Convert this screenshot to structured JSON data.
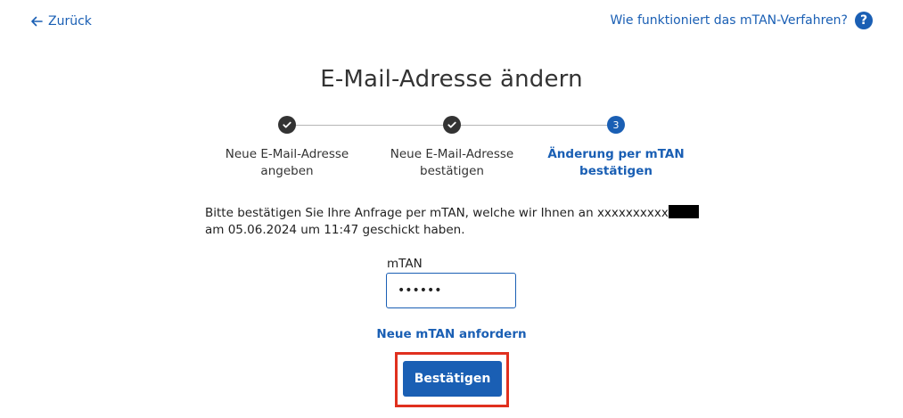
{
  "nav": {
    "back_label": "Zurück",
    "help_label": "Wie funktioniert das mTAN-Verfahren?",
    "help_icon_glyph": "?"
  },
  "page": {
    "title": "E-Mail-Adresse ändern"
  },
  "stepper": {
    "steps": [
      {
        "label_line1": "Neue E-Mail-Adresse",
        "label_line2": "angeben",
        "state": "done"
      },
      {
        "label_line1": "Neue E-Mail-Adresse",
        "label_line2": "bestätigen",
        "state": "done"
      },
      {
        "label_line1": "Änderung per mTAN",
        "label_line2": "bestätigen",
        "state": "active",
        "number": "3"
      }
    ]
  },
  "intro": {
    "text_before": "Bitte bestätigen Sie Ihre Anfrage per mTAN, welche wir Ihnen an ",
    "masked_number": "xxxxxxxxxx",
    "text_after": " am 05.06.2024 um 11:47 geschickt haben."
  },
  "form": {
    "mtan_label": "mTAN",
    "mtan_value": "••••••",
    "new_mtan_link": "Neue mTAN anfordern",
    "confirm_label": "Bestätigen"
  },
  "colors": {
    "accent": "#1a5fb4",
    "done_step": "#333333",
    "highlight": "#e0301e"
  }
}
